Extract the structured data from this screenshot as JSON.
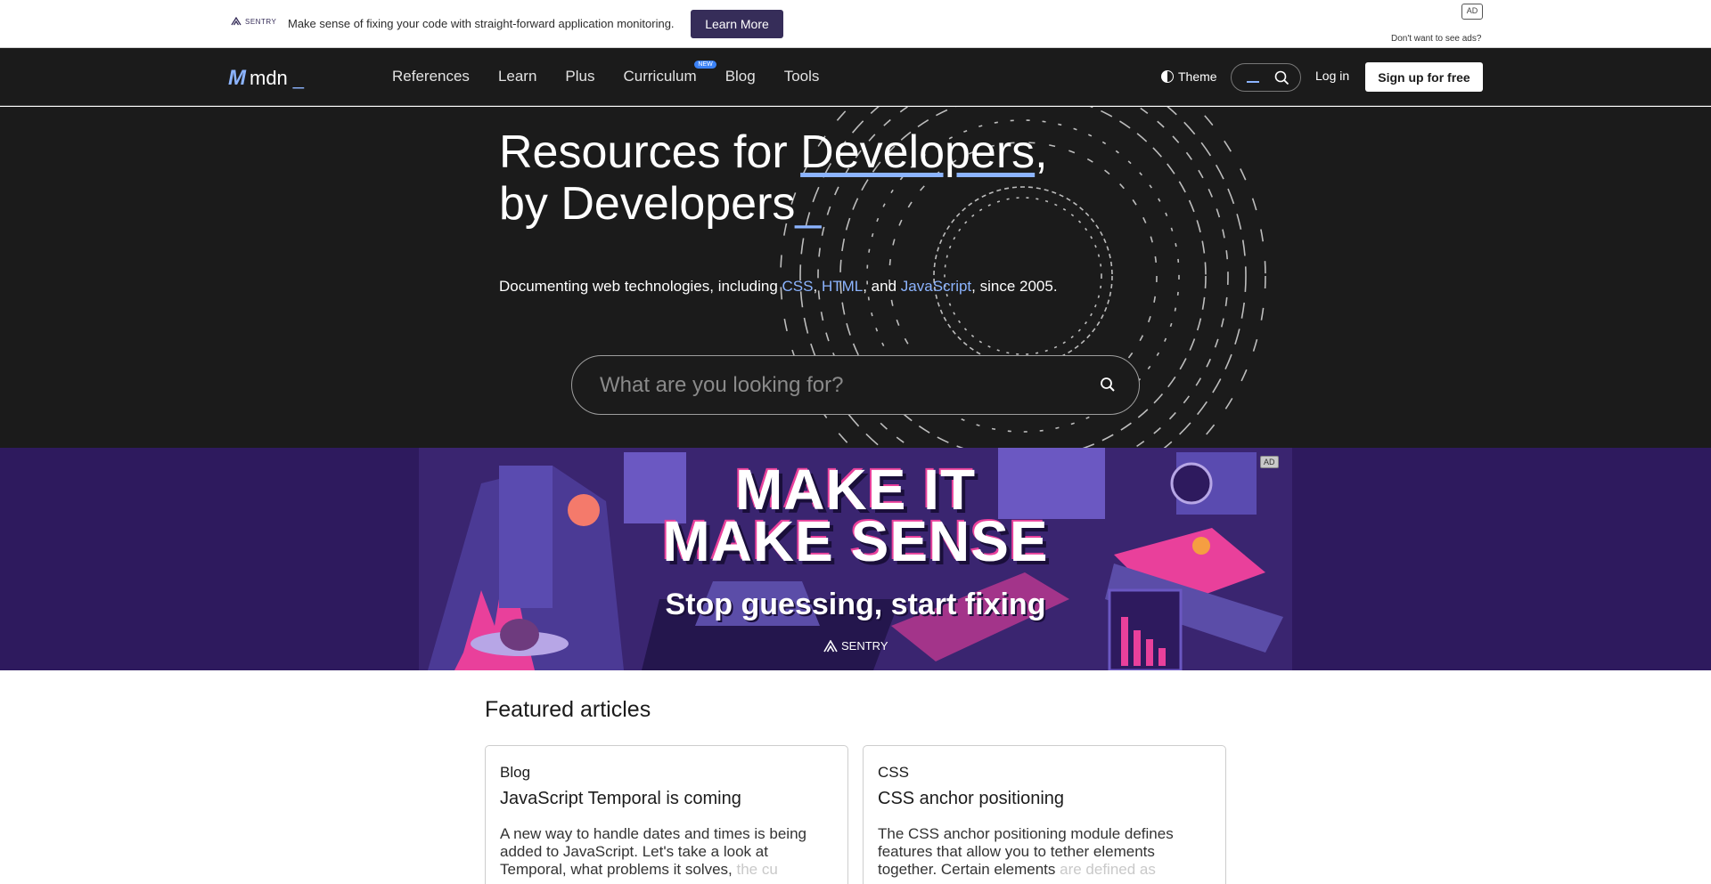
{
  "topad": {
    "brand": "SENTRY",
    "message": "Make sense of fixing your code with straight-forward application monitoring.",
    "cta": "Learn More",
    "badge": "AD",
    "noads": "Don't want to see ads?"
  },
  "nav": {
    "brand": "mdn",
    "items": [
      "References",
      "Learn",
      "Plus",
      "Curriculum",
      "Blog",
      "Tools"
    ],
    "new_badge": "NEW",
    "theme": "Theme",
    "login": "Log in",
    "signup": "Sign up for free"
  },
  "hero": {
    "title_a": "Resources for ",
    "title_b": "Developers",
    "title_c": ",",
    "title_d": "by Developers",
    "title_cursor": "_",
    "sub_a": "Documenting web technologies, including ",
    "sub_css": "CSS",
    "sub_sep1": ", ",
    "sub_html": "HTML",
    "sub_sep2": ", and ",
    "sub_js": "JavaScript",
    "sub_end": ", since 2005.",
    "search_placeholder": "What are you looking for?"
  },
  "banner": {
    "line1": "MAKE IT",
    "line2": "MAKE SENSE",
    "tagline": "Stop guessing, start fixing",
    "brand": "SENTRY",
    "badge": "AD"
  },
  "featured": {
    "heading": "Featured articles",
    "cards": [
      {
        "category": "Blog",
        "title": "JavaScript Temporal is coming",
        "desc": "A new way to handle dates and times is being added to JavaScript. Let's take a look at Temporal, what problems it solves, ",
        "desc_fade": "the cu"
      },
      {
        "category": "CSS",
        "title": "CSS anchor positioning",
        "desc": "The CSS anchor positioning module defines features that allow you to tether elements together. Certain elements ",
        "desc_fade": "are defined as"
      }
    ]
  },
  "colors": {
    "accent": "#8cb4ff",
    "nav_bg": "#1b1b1b",
    "banner_bg": "#2e1a5e",
    "sentry": "#362d59"
  }
}
